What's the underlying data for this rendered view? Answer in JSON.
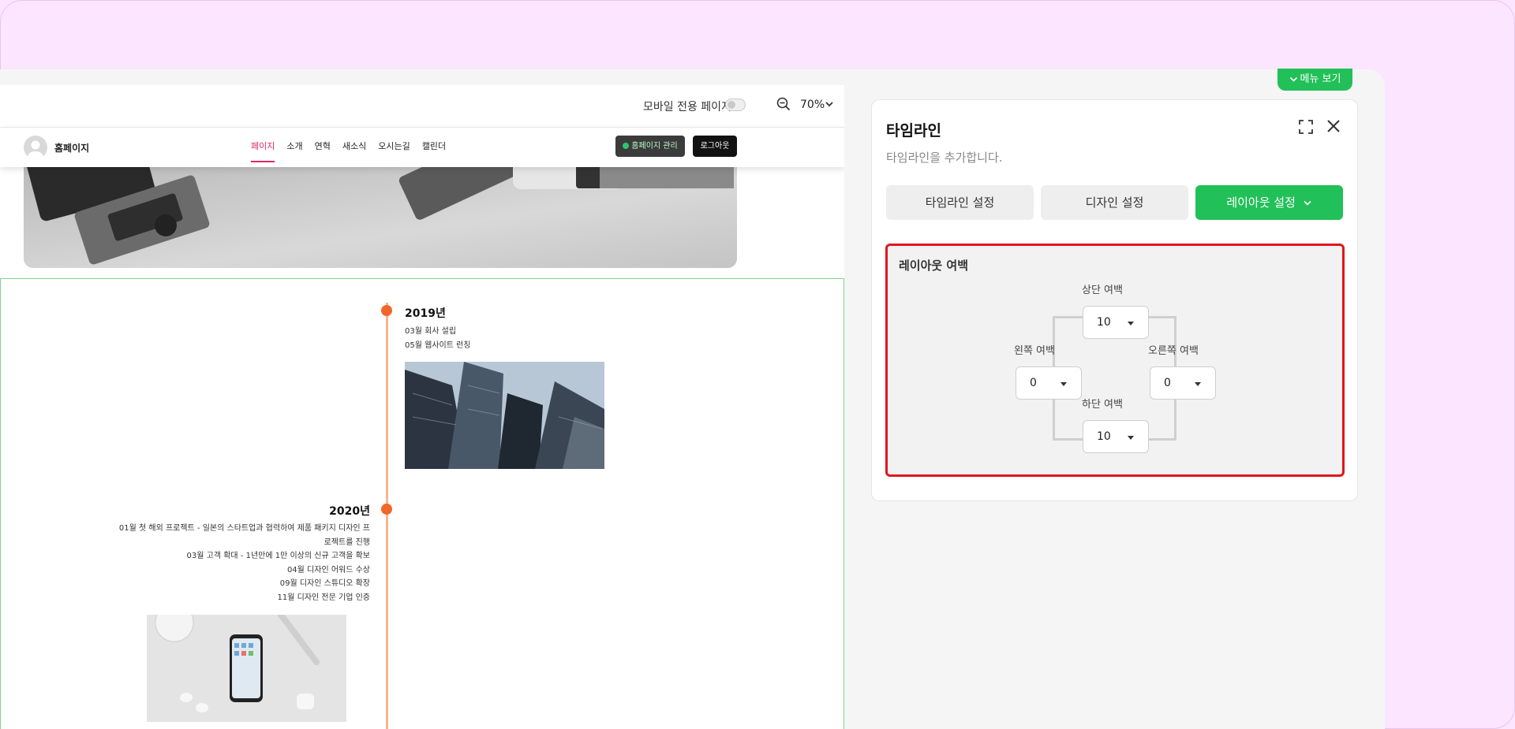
{
  "preview": {
    "topbar": {
      "mobile_label": "모바일 전용 페이지",
      "zoom": "70%"
    },
    "site": {
      "name": "홈페이지",
      "nav": [
        "페이지",
        "소개",
        "연혁",
        "새소식",
        "오시는길",
        "캘린더"
      ],
      "manage_button": "홈페이지 관리",
      "logout_button": "로그아웃"
    },
    "timeline": [
      {
        "year": "2019년",
        "events": [
          "03월 회사 설립",
          "05월 웹사이트 런칭"
        ]
      },
      {
        "year": "2020년",
        "events": [
          "01월 첫 해외 프로젝트 - 일본의 스타트업과 협력하여 제품 패키지 디자인 프",
          "로젝트를 진행",
          "03월 고객 확대 - 1년만에 1만 이상의 신규 고객을 확보",
          "04월 디자인 어워드 수상",
          "09월 디자인 스튜디오 확장",
          "11월 디자인 전문 기업 인증"
        ]
      }
    ]
  },
  "panel": {
    "menu_button": "메뉴 보기",
    "title": "타임라인",
    "subtitle": "타임라인을 추가합니다.",
    "tabs": [
      "타임라인 설정",
      "디자인 설정",
      "레이아웃 설정"
    ],
    "section_title": "레이아웃 여백",
    "margins": {
      "top": {
        "label": "상단 여백",
        "value": "10"
      },
      "left": {
        "label": "왼쪽 여백",
        "value": "0"
      },
      "right": {
        "label": "오른쪽 여백",
        "value": "0"
      },
      "bottom": {
        "label": "하단 여백",
        "value": "10"
      }
    }
  },
  "colors": {
    "accent_green": "#22c058",
    "highlight_red": "#e0161f",
    "timeline_orange": "#f2662a",
    "nav_active": "#e1256d"
  }
}
